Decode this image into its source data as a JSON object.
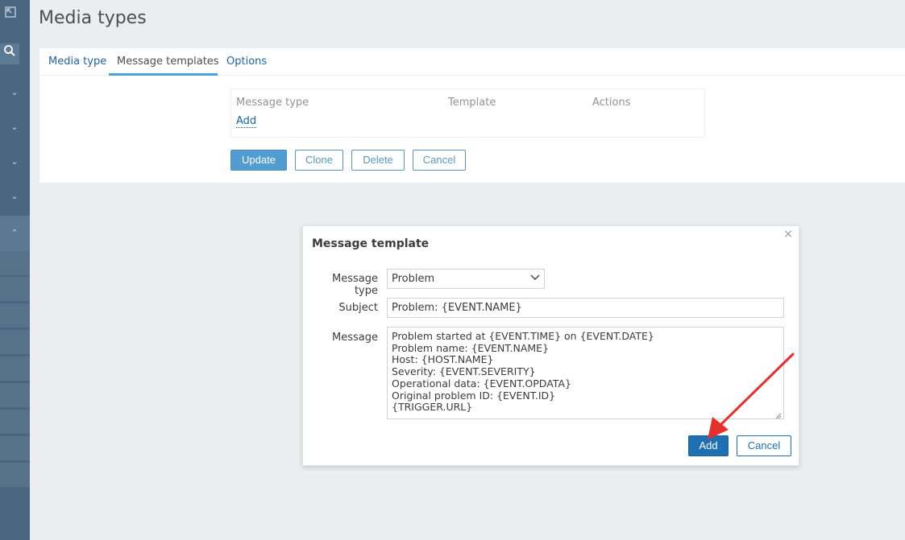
{
  "page": {
    "title": "Media types"
  },
  "sidebar": {
    "icons": [
      "expand-icon",
      "search-icon",
      "chevron-down-icon",
      "chevron-down-icon",
      "chevron-down-icon",
      "chevron-down-icon",
      "chevron-up-icon"
    ]
  },
  "tabs": [
    {
      "label": "Media type"
    },
    {
      "label": "Message templates"
    },
    {
      "label": "Options"
    }
  ],
  "templates_table": {
    "headers": [
      "Message type",
      "Template",
      "Actions"
    ],
    "add_label": "Add"
  },
  "form_buttons": {
    "update": "Update",
    "clone": "Clone",
    "delete": "Delete",
    "cancel": "Cancel"
  },
  "dialog": {
    "title": "Message template",
    "close_symbol": "×",
    "message_type_label": "Message type",
    "message_type_value": "Problem",
    "subject_label": "Subject",
    "subject_value": "Problem: {EVENT.NAME}",
    "message_label": "Message",
    "message_lines": [
      "Problem started at {EVENT.TIME} on {EVENT.DATE}",
      "Problem name: {EVENT.NAME}",
      "Host: {HOST.NAME}",
      "Severity: {EVENT.SEVERITY}",
      "Operational data: {EVENT.OPDATA}",
      "Original problem ID: {EVENT.ID}",
      "{TRIGGER.URL}"
    ],
    "add_label": "Add",
    "cancel_label": "Cancel"
  },
  "colors": {
    "sidebar": "#4a6680",
    "accent": "#1f70b1",
    "annotation_arrow": "#e8302a"
  }
}
